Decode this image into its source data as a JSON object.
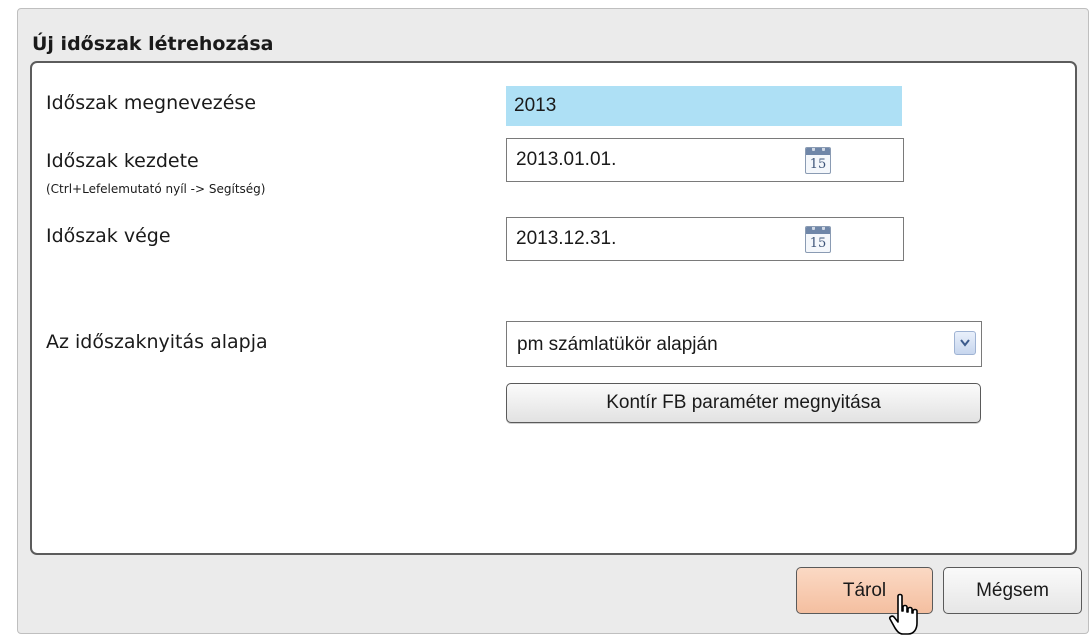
{
  "dialog": {
    "title": "Új időszak létrehozása"
  },
  "form": {
    "name_label": "Időszak megnevezése",
    "name_value": "2013",
    "start_label": "Időszak kezdete",
    "start_hint": "(Ctrl+Lefelemutató nyíl -> Segítség)",
    "start_value": "2013.01.01.",
    "end_label": "Időszak vége",
    "end_value": "2013.12.31.",
    "calendar_day": "15",
    "basis_label": "Az időszaknyitás alapja",
    "basis_value": "pm számlatükör alapján",
    "open_params_label": "Kontír FB paraméter megnyitása"
  },
  "footer": {
    "save_label": "Tárol",
    "cancel_label": "Mégsem"
  },
  "icons": {
    "calendar": "calendar-icon",
    "dropdown": "chevron-down-icon",
    "cursor": "hand-pointer-icon"
  },
  "colors": {
    "name_field_bg": "#aee0f5",
    "save_button_bg": "#f4bfa0",
    "dialog_bg": "#ebebeb"
  }
}
